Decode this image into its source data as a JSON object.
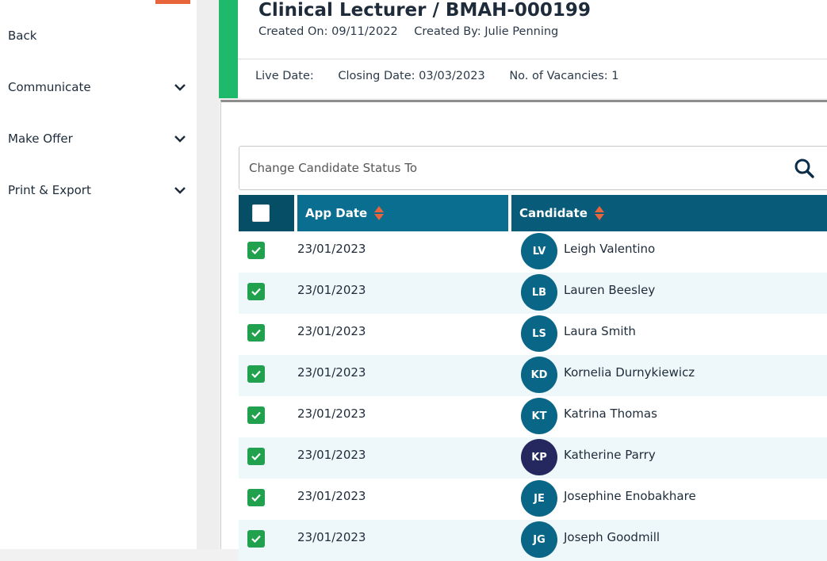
{
  "sidebar": {
    "items": [
      {
        "label": "Back"
      },
      {
        "label": "Communicate"
      },
      {
        "label": "Make Offer"
      },
      {
        "label": "Print & Export"
      }
    ]
  },
  "header": {
    "title": "Clinical Lecturer / BMAH-000199",
    "created_on": "Created On: 09/11/2022",
    "created_by": "Created By: Julie Penning",
    "live_date": "Live Date:",
    "closing_date": "Closing Date: 03/03/2023",
    "vacancies": "No. of Vacancies: 1"
  },
  "search": {
    "placeholder": "Change Candidate Status To"
  },
  "table": {
    "columns": [
      "App Date",
      "Candidate"
    ],
    "rows": [
      {
        "date": "23/01/2023",
        "initials": "LV",
        "name": "Leigh Valentino",
        "checked": true
      },
      {
        "date": "23/01/2023",
        "initials": "LB",
        "name": "Lauren Beesley",
        "checked": true
      },
      {
        "date": "23/01/2023",
        "initials": "LS",
        "name": "Laura Smith",
        "checked": true
      },
      {
        "date": "23/01/2023",
        "initials": "KD",
        "name": "Kornelia Durnykiewicz",
        "checked": true
      },
      {
        "date": "23/01/2023",
        "initials": "KT",
        "name": "Katrina Thomas",
        "checked": true
      },
      {
        "date": "23/01/2023",
        "initials": "KP",
        "name": "Katherine Parry",
        "checked": true
      },
      {
        "date": "23/01/2023",
        "initials": "JE",
        "name": "Josephine Enobakhare",
        "checked": true
      },
      {
        "date": "23/01/2023",
        "initials": "JG",
        "name": "Joseph Goodmill",
        "checked": true
      }
    ]
  },
  "icons": {
    "search": "search-icon",
    "chevron": "chevron-down-icon",
    "sort": "sort-icon",
    "check": "checkmark-icon"
  },
  "colors": {
    "accent_green": "#1fb96b",
    "header_teal": "#075f7c",
    "avatar_teal": "#0a6687",
    "avatar_dark": "#24285e",
    "checkbox_green": "#21a04d",
    "sort_orange": "#e8643b"
  }
}
